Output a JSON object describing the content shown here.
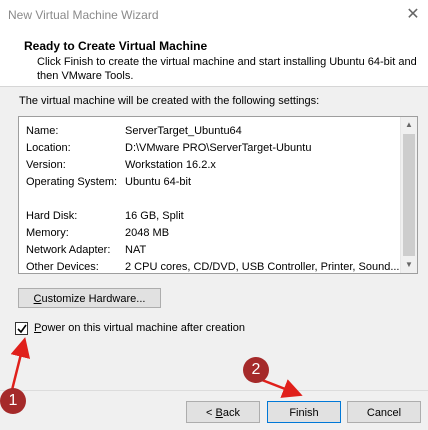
{
  "window": {
    "title": "New Virtual Machine Wizard",
    "close_glyph": "✕"
  },
  "header": {
    "title": "Ready to Create Virtual Machine",
    "description": "Click Finish to create the virtual machine and start installing Ubuntu 64-bit and then VMware Tools."
  },
  "intro": "The virtual machine will be created with the following settings:",
  "settings": [
    {
      "key": "Name:",
      "value": "ServerTarget_Ubuntu64"
    },
    {
      "key": "Location:",
      "value": "D:\\VMware PRO\\ServerTarget-Ubuntu"
    },
    {
      "key": "Version:",
      "value": "Workstation 16.2.x"
    },
    {
      "key": "Operating System:",
      "value": "Ubuntu 64-bit"
    },
    {
      "key": "Hard Disk:",
      "value": "16 GB, Split"
    },
    {
      "key": "Memory:",
      "value": "2048 MB"
    },
    {
      "key": "Network Adapter:",
      "value": "NAT"
    },
    {
      "key": "Other Devices:",
      "value": "2 CPU cores, CD/DVD, USB Controller, Printer, Sound..."
    }
  ],
  "buttons": {
    "customize_hotkey": "C",
    "customize_rest": "ustomize Hardware...",
    "back_prefix": "< ",
    "back_hotkey": "B",
    "back_rest": "ack",
    "finish": "Finish",
    "cancel": "Cancel"
  },
  "power_on": {
    "checked": true,
    "hotkey": "P",
    "rest": "ower on this virtual machine after creation"
  },
  "annotations": {
    "marker_1": "1",
    "marker_2": "2",
    "color": "#a52a2a",
    "arrow_color": "#e0201b"
  }
}
